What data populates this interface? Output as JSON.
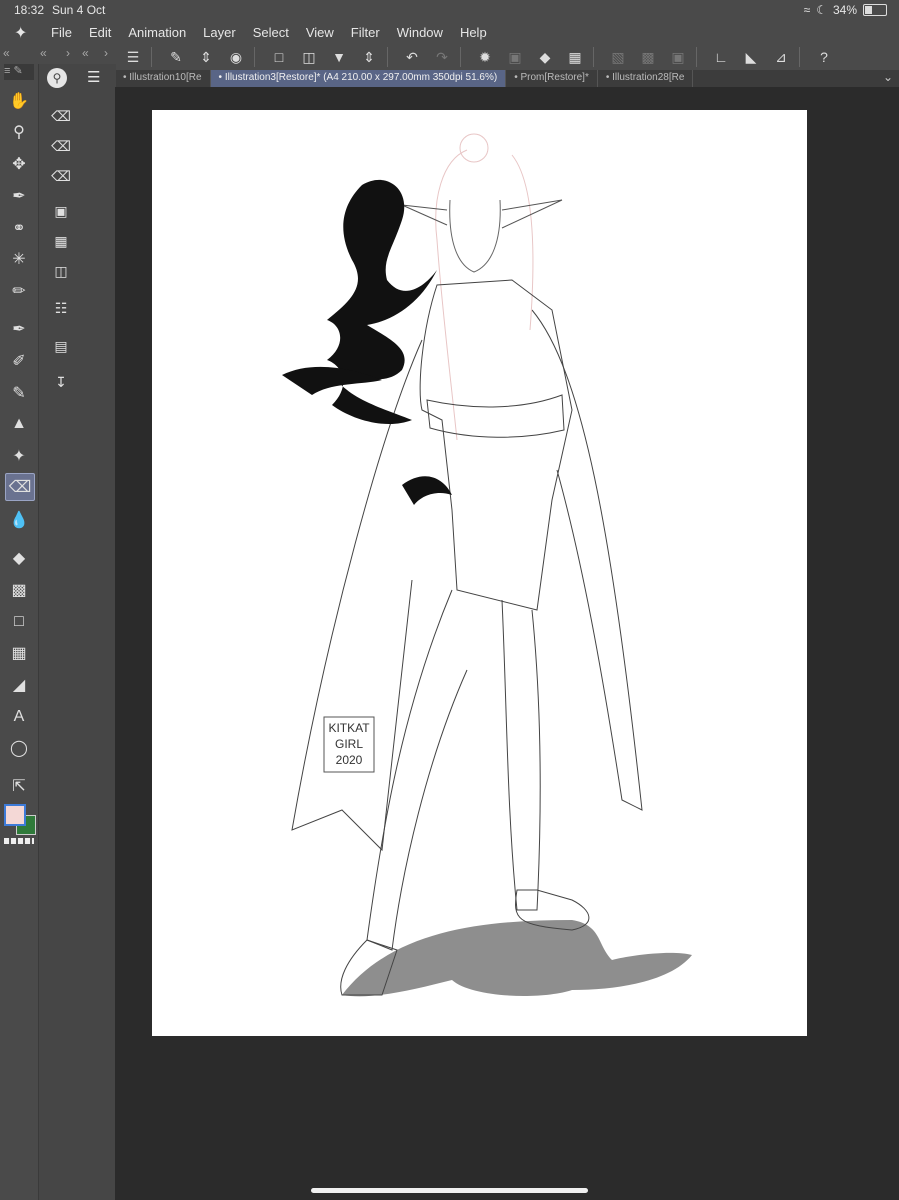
{
  "status": {
    "time": "18:32",
    "date": "Sun 4 Oct",
    "battery": "34%",
    "battery_level": 0.34
  },
  "menu": {
    "items": [
      "File",
      "Edit",
      "Animation",
      "Layer",
      "Select",
      "View",
      "Filter",
      "Window",
      "Help"
    ]
  },
  "tabs": [
    {
      "label": "Illustration10[Re"
    },
    {
      "label": "Illustration3[Restore]* (A4 210.00 x 297.00mm 350dpi 51.6%)"
    },
    {
      "label": "Prom[Restore]*"
    },
    {
      "label": "Illustration28[Re"
    }
  ],
  "artwork": {
    "signature_lines": [
      "KITKAT",
      "GIRL",
      "2020"
    ]
  },
  "colors": {
    "main": "#f4d8d6",
    "sub": "#2f7a3a",
    "accent": "#596586"
  }
}
